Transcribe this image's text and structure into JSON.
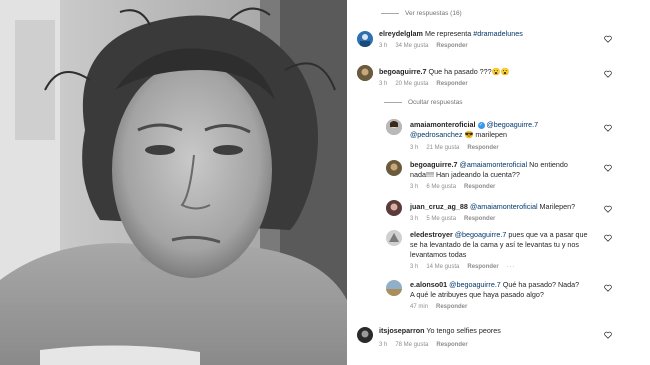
{
  "view_replies": "Ver respuestas (16)",
  "hide_replies": "Ocultar respuestas",
  "comments": [
    {
      "user": "elreydelglam",
      "text": "Me representa ",
      "hashtag": "#dramadelunes",
      "time": "3 h",
      "likes": "34 Me gusta",
      "reply": "Responder"
    },
    {
      "user": "begoaguirre.7",
      "text": "Que ha pasado ???😮😮",
      "time": "3 h",
      "likes": "20 Me gusta",
      "reply": "Responder"
    },
    {
      "user": "amaiamonteroficial",
      "mention": "@begoaguirre.7",
      "line2_mention": "@pedrosanchez",
      "line2_text": " 😎 marilepen",
      "time": "3 h",
      "likes": "21 Me gusta",
      "reply": "Responder"
    },
    {
      "user": "begoaguirre.7",
      "mention": "@amaiamonteroficial",
      "text": " No entiendo",
      "line2": "nada!!!! Han jadeando la cuenta??",
      "time": "3 h",
      "likes": "6 Me gusta",
      "reply": "Responder"
    },
    {
      "user": "juan_cruz_ag_88",
      "mention": "@amaiamonteroficial",
      "text": " Marilepen?",
      "time": "3 h",
      "likes": "5 Me gusta",
      "reply": "Responder"
    },
    {
      "user": "eledestroyer",
      "mention": "@begoaguirre.7",
      "text": " pues que va a pasar que",
      "line2": "se ha levantado de la cama y así te levantas tu y nos",
      "line3": "levantamos todas",
      "time": "3 h",
      "likes": "14 Me gusta",
      "reply": "Responder"
    },
    {
      "user": "e.alonso01",
      "mention": "@begoaguirre.7",
      "text": " Qué ha pasado? Nada?",
      "line2": "A qué le atribuyes que haya pasado algo?",
      "time": "47 min",
      "reply": "Responder"
    },
    {
      "user": "itsjoseparron",
      "text": "Yo tengo selfies peores",
      "time": "3 h",
      "likes": "78 Me gusta",
      "reply": "Responder"
    }
  ],
  "icons": [
    "heart-icon",
    "verified-icon",
    "more-icon"
  ]
}
